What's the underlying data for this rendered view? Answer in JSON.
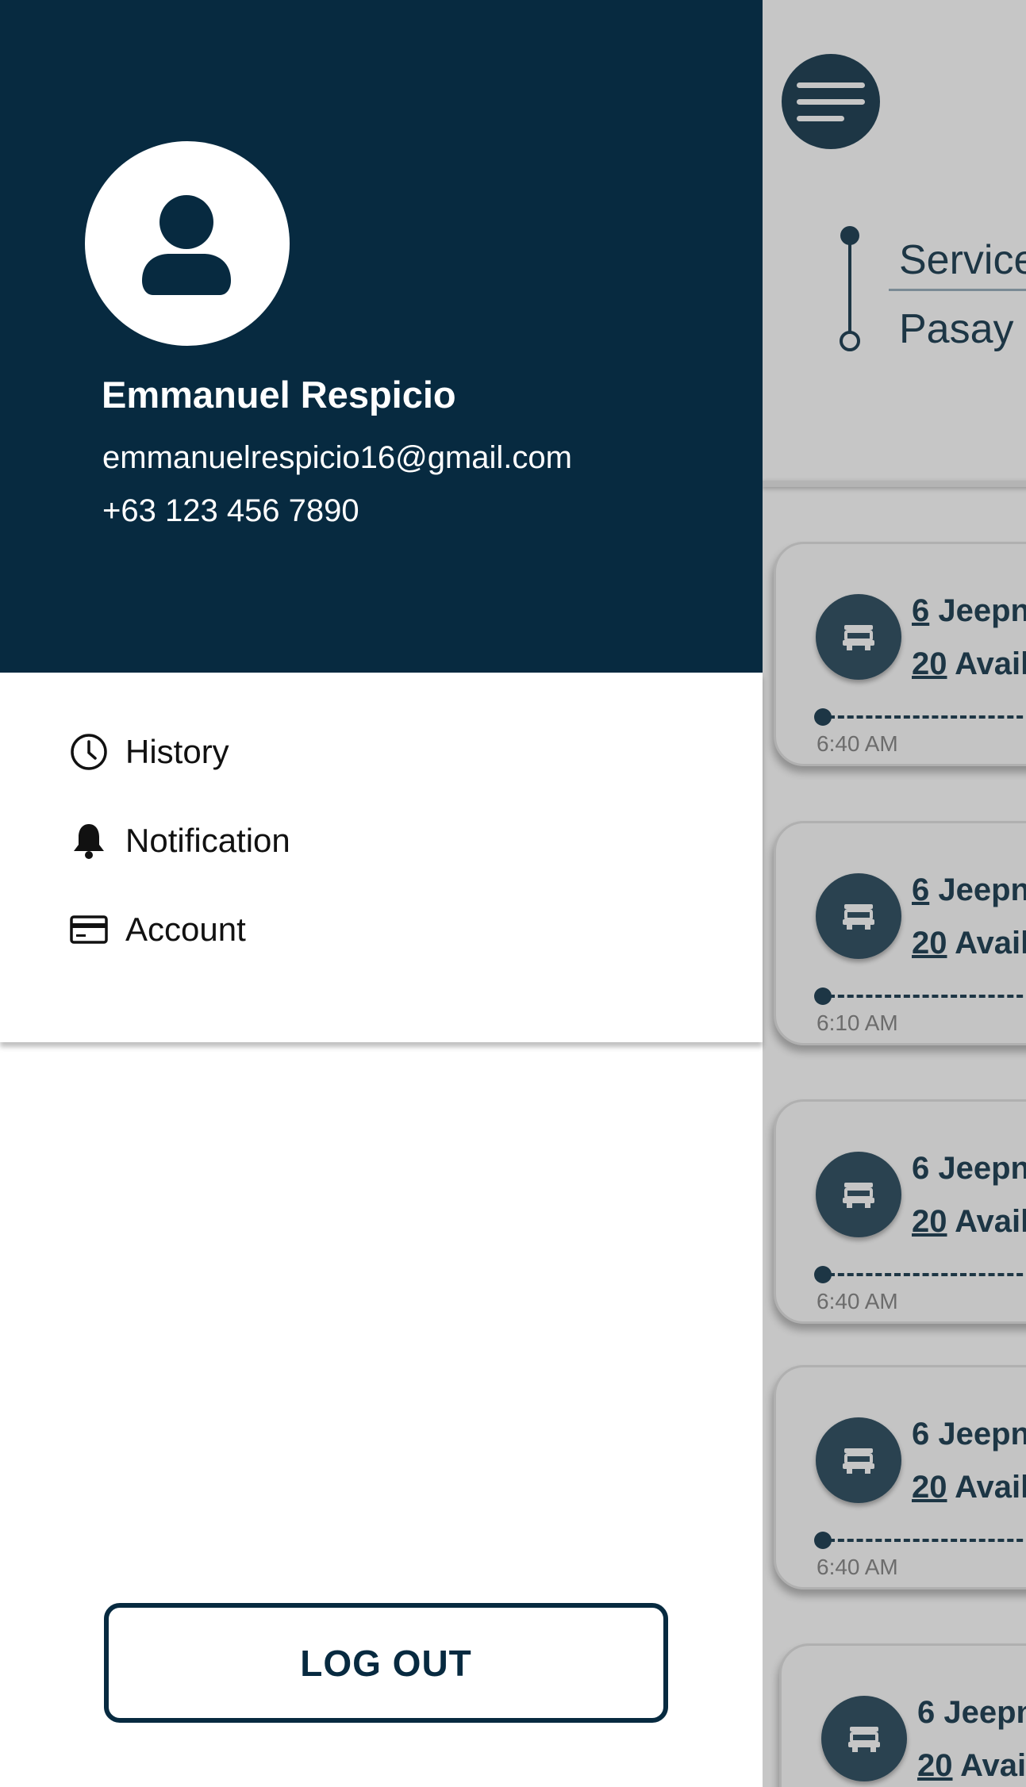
{
  "drawer": {
    "user": {
      "name": "Emmanuel Respicio",
      "email": "emmanuelrespicio16@gmail.com",
      "phone": "+63 123 456 7890"
    },
    "menu": [
      {
        "label": "History",
        "icon": "clock-icon"
      },
      {
        "label": "Notification",
        "icon": "bell-icon"
      },
      {
        "label": "Account",
        "icon": "credit-card-icon"
      }
    ],
    "logout_label": "LOG OUT"
  },
  "background": {
    "route_from": "Service",
    "route_to": "Pasay N",
    "trips": [
      {
        "count": "6",
        "count_suffix": " Jeepn",
        "seats": "20",
        "seats_suffix": " Avail",
        "time": "6:40 AM"
      },
      {
        "count": "6",
        "count_suffix": " Jeepn",
        "seats": "20",
        "seats_suffix": " Avail",
        "time": "6:10 AM"
      },
      {
        "count": "6",
        "count_suffix": " Jeepn",
        "seats": "20",
        "seats_suffix": " Avail",
        "time": "6:40 AM"
      },
      {
        "count": "6",
        "count_suffix": " Jeepn",
        "seats": "20",
        "seats_suffix": " Avail",
        "time": "6:40 AM"
      },
      {
        "count": "6",
        "count_suffix": " Jeepn",
        "seats": "20",
        "seats_suffix": " Avai",
        "time": ""
      }
    ]
  },
  "colors": {
    "primary": "#072a40",
    "overlay_gray": "#c6c6c6",
    "white": "#ffffff"
  }
}
